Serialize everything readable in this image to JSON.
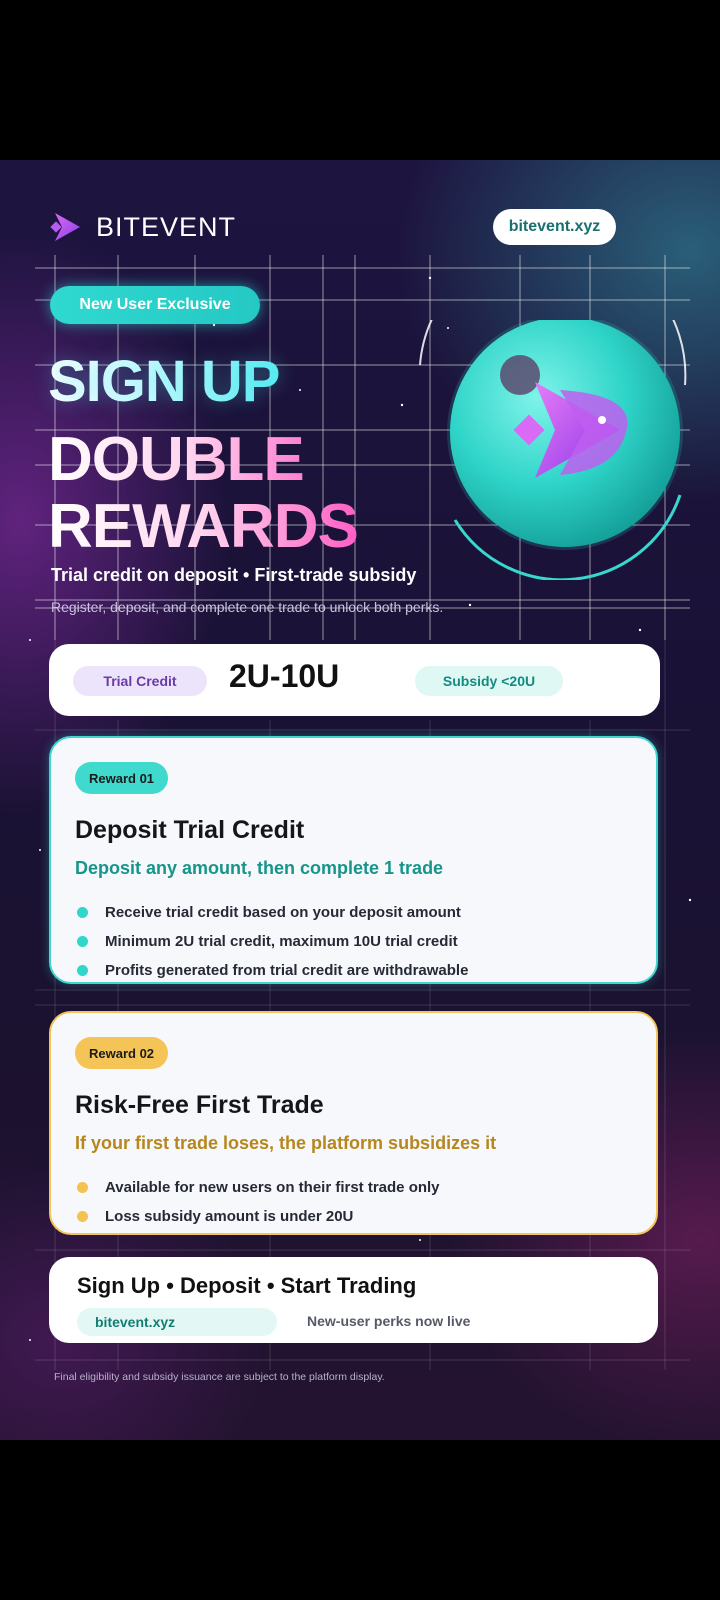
{
  "brand": {
    "name": "BITEVENT",
    "logo_icon": "bitevent-logo-icon"
  },
  "header": {
    "site_url": "bitevent.xyz"
  },
  "hero": {
    "badge": "New User Exclusive",
    "line1": "SIGN UP",
    "line2": "DOUBLE",
    "line3": "REWARDS",
    "tagline": "Trial credit on deposit  •  First-trade subsidy",
    "description": "Register, deposit, and complete one trade to unlock both perks."
  },
  "summary": {
    "trial_label": "Trial Credit",
    "range": "2U-10U",
    "subsidy_label": "Subsidy <20U"
  },
  "rewards": [
    {
      "badge": "Reward 01",
      "title": "Deposit Trial Credit",
      "subtitle": "Deposit any amount, then complete 1 trade",
      "bullets": [
        "Receive trial credit based on your deposit amount",
        "Minimum 2U trial credit, maximum 10U trial credit",
        "Profits generated from trial credit are withdrawable"
      ]
    },
    {
      "badge": "Reward 02",
      "title": "Risk-Free First Trade",
      "subtitle": "If your first trade loses, the platform subsidizes it",
      "bullets": [
        "Available for new users on their first trade only",
        "Loss subsidy amount is under 20U"
      ]
    }
  ],
  "cta": {
    "title": "Sign Up  •  Deposit  •  Start Trading",
    "site": "bitevent.xyz",
    "note": "New-user perks now live"
  },
  "footer": {
    "disclaimer": "Final eligibility and subsidy issuance are subject to the platform display."
  },
  "colors": {
    "accent_teal": "#2fd9d0",
    "accent_gold": "#f4c250",
    "accent_purple": "#a64cf0",
    "accent_pink": "#ff5ec4"
  }
}
